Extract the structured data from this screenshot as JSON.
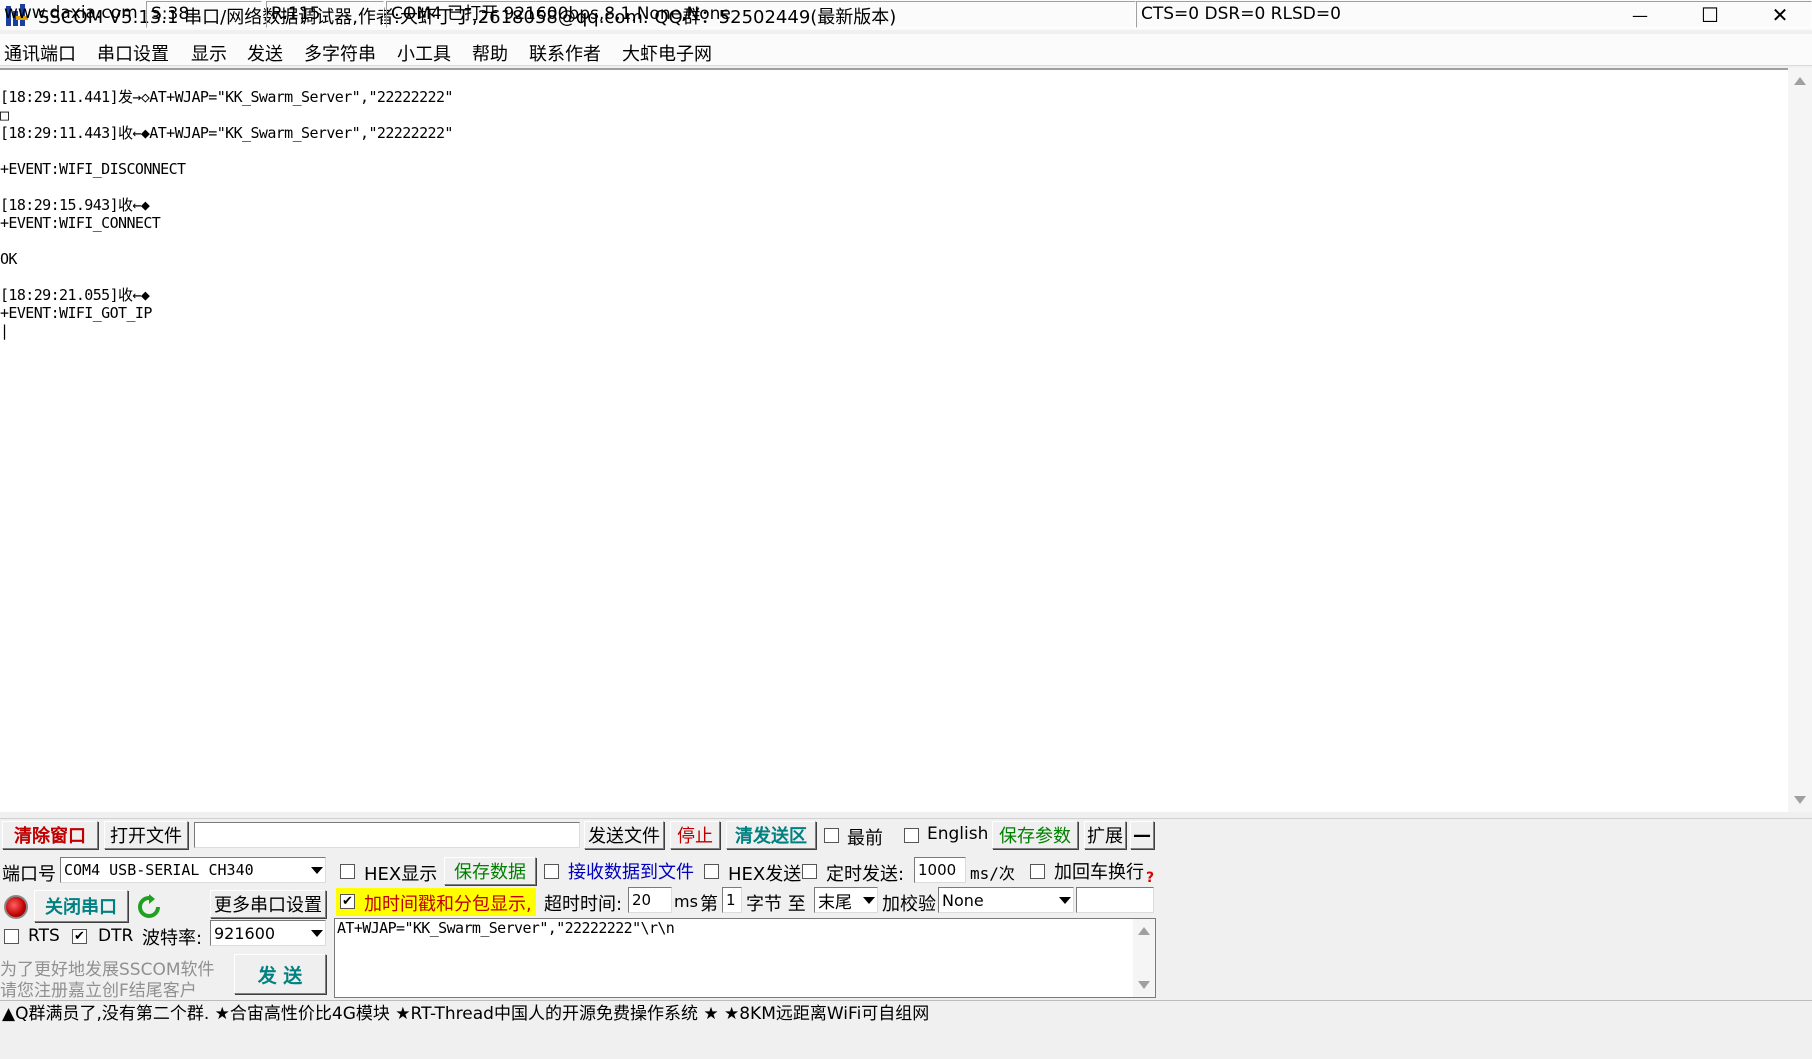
{
  "window": {
    "title": "SSCOM V5.13.1 串口/网络数据调试器,作者:大虾丁丁,2618058@qq.com. QQ群：52502449(最新版本)",
    "minimize_symbol": "—",
    "maximize_symbol": "☐",
    "close_symbol": "✕"
  },
  "menu": [
    "通讯端口",
    "串口设置",
    "显示",
    "发送",
    "多字符串",
    "小工具",
    "帮助",
    "联系作者",
    "大虾电子网"
  ],
  "receive_log": [
    "[18:29:11.441]发→◇AT+WJAP=\"KK_Swarm_Server\",\"22222222\"",
    "□",
    "[18:29:11.443]收←◆AT+WJAP=\"KK_Swarm_Server\",\"22222222\"",
    "",
    "+EVENT:WIFI_DISCONNECT",
    "",
    "[18:29:15.943]收←◆",
    "+EVENT:WIFI_CONNECT",
    "",
    "OK",
    "",
    "[18:29:21.055]收←◆",
    "+EVENT:WIFI_GOT_IP",
    "|"
  ],
  "toolbar": {
    "clear_window": "清除窗口",
    "open_file": "打开文件",
    "file_path": "",
    "send_file": "发送文件",
    "stop": "停止",
    "clear_send": "清发送区",
    "topmost": "最前",
    "english": "English",
    "save_params": "保存参数",
    "expand": "扩展",
    "collapse": "—"
  },
  "port": {
    "label": "端口号",
    "value": "COM4 USB-SERIAL CH340",
    "close_port": "关闭串口",
    "more_settings": "更多串口设置",
    "rts": "RTS",
    "dtr": "DTR",
    "baud_label": "波特率:",
    "baud_value": "921600",
    "promo_line1": "为了更好地发展SSCOM软件",
    "promo_line2": "请您注册嘉立创F结尾客户",
    "send": "发  送"
  },
  "options": {
    "hex_display": "HEX显示",
    "save_data": "保存数据",
    "receive_to_file": "接收数据到文件",
    "hex_send": "HEX发送",
    "timed_send": "定时发送:",
    "interval_value": "1000",
    "interval_unit": "ms/次",
    "add_crlf": "加回车换行",
    "timestamp": "加时间戳和分包显示,",
    "timeout_label": "超时时间:",
    "timeout_value": "20",
    "timeout_unit": "ms",
    "byte_prefix": "第",
    "byte_index": "1",
    "byte_suffix": "字节 至",
    "byte_end": "末尾",
    "checksum_label": "加校验",
    "checksum_value": "None",
    "checksum_result": "",
    "help_mark": "?"
  },
  "send_text": "AT+WJAP=\"KK_Swarm_Server\",\"22222222\"\\r\\n",
  "ticker": "▲Q群满员了,没有第二个群. ★合宙高性价比4G模块 ★RT-Thread中国人的开源免费操作系统 ★ ★8KM远距离WiFi可自组网",
  "status": {
    "website": "www.daxia.com",
    "sent": "S:38",
    "received": "R:115",
    "port_status": "COM4 已打开  921600bps,8,1,None,None",
    "lines": "CTS=0 DSR=0 RLSD=0"
  },
  "colors": {
    "red_text": "#c00000",
    "green_text": "#008000",
    "blue_text": "#0000c0",
    "highlight": "#ffff00"
  }
}
